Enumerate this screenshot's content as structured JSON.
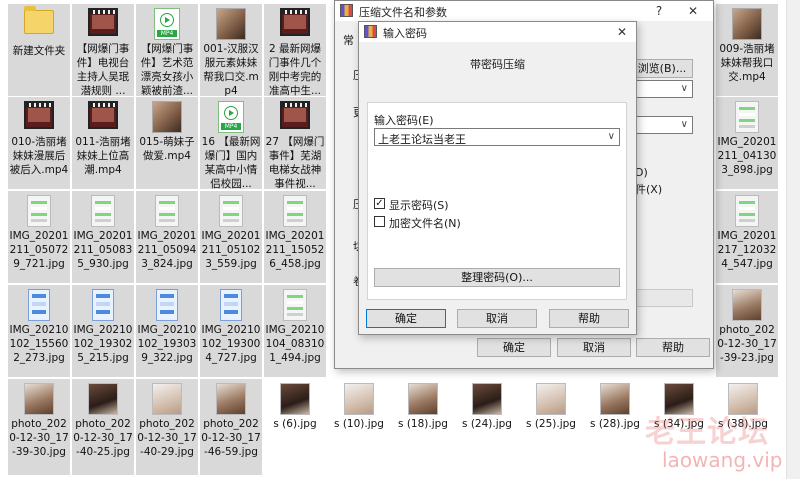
{
  "explorer": {
    "tiles_top": [
      {
        "label": "新建文件夹",
        "icon": "folder-icon"
      },
      {
        "label": "【网爆门事件】电视台主持人吴珉潜规则 ...",
        "icon": "video-icon"
      },
      {
        "label": "【网爆门事件】艺术范漂亮女孩小颖被前渣...",
        "icon": "mp4-icon"
      },
      {
        "label": "001-汉服汉服元素妹妹帮我口交.mp4",
        "icon": "photo-icon"
      },
      {
        "label": "2 最新网爆门事件几个刚中考完的准高中生...",
        "icon": "video-icon"
      }
    ],
    "tiles_row2": [
      {
        "label": "010-浩丽堵妹妹漫展后被后入.mp4",
        "icon": "video-icon"
      },
      {
        "label": "011-浩丽堵妹妹上位高潮.mp4",
        "icon": "video-icon"
      },
      {
        "label": "015-萌妹子做爱.mp4",
        "icon": "photo-icon"
      },
      {
        "label": "16 【最新网爆门】国内某高中小情侣校园...",
        "icon": "mp4-icon"
      },
      {
        "label": "27 【网爆门事件】芜湖电梯女战神事件视...",
        "icon": "video-icon"
      }
    ],
    "tiles_row3": [
      {
        "label": "IMG_20201211_050729_721.jpg",
        "icon": "chat-icon"
      },
      {
        "label": "IMG_20201211_050835_930.jpg",
        "icon": "chat-icon"
      },
      {
        "label": "IMG_20201211_050943_824.jpg",
        "icon": "chat-icon"
      },
      {
        "label": "IMG_20201211_051023_559.jpg",
        "icon": "chat-icon"
      },
      {
        "label": "IMG_20201211_150526_458.jpg",
        "icon": "chat-icon"
      }
    ],
    "tiles_row4": [
      {
        "label": "IMG_20210102_155602_273.jpg",
        "icon": "phone-icon"
      },
      {
        "label": "IMG_20210102_193025_215.jpg",
        "icon": "phone-icon"
      },
      {
        "label": "IMG_20210102_193039_322.jpg",
        "icon": "phone-icon"
      },
      {
        "label": "IMG_20210102_193004_727.jpg",
        "icon": "phone-icon"
      },
      {
        "label": "IMG_20210104_083101_494.jpg",
        "icon": "chat-icon"
      }
    ],
    "tiles_row5": [
      {
        "label": "photo_2020-12-30_17-39-30.jpg",
        "icon": "jpg-icon"
      },
      {
        "label": "photo_2020-12-30_17-40-25.jpg",
        "icon": "jpg-icon"
      },
      {
        "label": "photo_2020-12-30_17-40-29.jpg",
        "icon": "jpg-icon"
      },
      {
        "label": "photo_2020-12-30_17-46-59.jpg",
        "icon": "jpg-icon"
      },
      {
        "label": "s (6).jpg",
        "icon": "jpg-icon"
      },
      {
        "label": "s (10).jpg",
        "icon": "jpg-icon"
      },
      {
        "label": "s (18).jpg",
        "icon": "jpg-icon"
      },
      {
        "label": "s (24).jpg",
        "icon": "jpg-icon"
      },
      {
        "label": "s (25).jpg",
        "icon": "jpg-icon"
      },
      {
        "label": "s (28).jpg",
        "icon": "jpg-icon"
      },
      {
        "label": "s (34).jpg",
        "icon": "jpg-icon"
      },
      {
        "label": "s (38).jpg",
        "icon": "jpg-icon"
      }
    ],
    "tiles_right": [
      {
        "label": "009-浩丽堵妹妹帮我口交.mp4",
        "icon": "photo-icon"
      },
      {
        "label": "IMG_20201211_041303_898.jpg",
        "icon": "chat-icon"
      },
      {
        "label": "IMG_20201217_120324_547.jpg",
        "icon": "chat-icon"
      },
      {
        "label": "photo_2020-12-30_17-39-23.jpg",
        "icon": "jpg-icon"
      }
    ]
  },
  "archive_dialog": {
    "title": "压缩文件名和参数",
    "help_glyph": "?",
    "close_glyph": "✕",
    "tab_general": "常",
    "browse_button": "浏览(B)...",
    "partial_left": [
      "压",
      "更",
      "压",
      "切",
      "卷"
    ],
    "partial_option_d": "D)",
    "partial_option_x": "件(X)",
    "ok": "确定",
    "cancel": "取消",
    "help": "帮助"
  },
  "password_dialog": {
    "title": "输入密码",
    "close_glyph": "✕",
    "heading": "带密码压缩",
    "password_label": "输入密码(E)",
    "password_value": "上老王论坛当老王",
    "show_password_label": "显示密码(S)",
    "show_password_checked": true,
    "encrypt_names_label": "加密文件名(N)",
    "encrypt_names_checked": false,
    "organize_button": "整理密码(O)...",
    "ok": "确定",
    "cancel": "取消",
    "help": "帮助"
  },
  "watermark": {
    "cn": "老王论坛",
    "en": "laowang.vip"
  }
}
